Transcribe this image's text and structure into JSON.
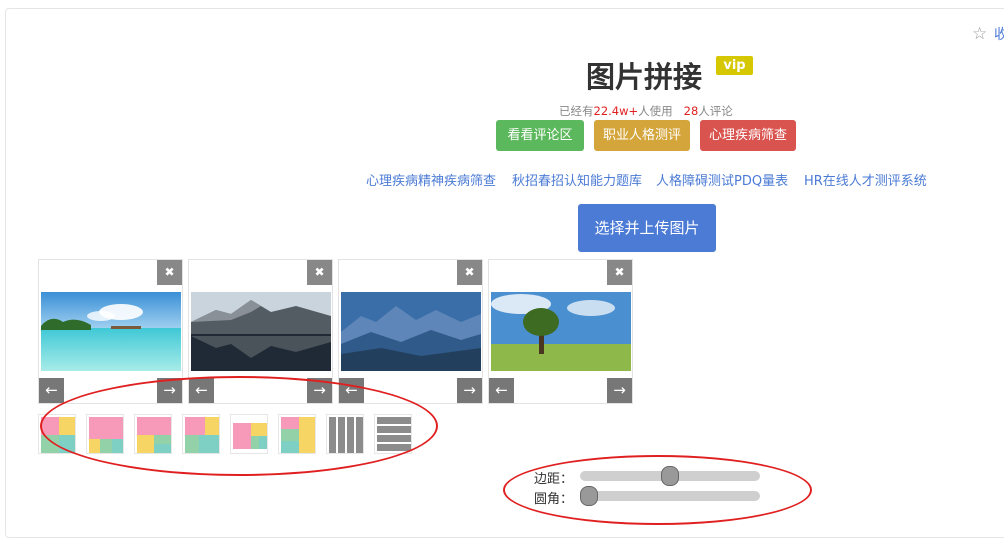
{
  "header": {
    "favorite_label": "收",
    "title": "图片拼接",
    "vip_badge": "vip",
    "stats": {
      "prefix": "已经有",
      "users": "22.4w+",
      "users_suffix": "人使用",
      "comments": "28",
      "comments_suffix": "人评论"
    }
  },
  "buttons": {
    "view_comments": "看看评论区",
    "career_test": "职业人格测评",
    "mental_screening": "心理疾病筛查"
  },
  "links": [
    "心理疾病精神疾病筛查",
    "秋招春招认知能力题库",
    "人格障碍测试PDQ量表",
    "HR在线人才测评系统"
  ],
  "upload_button": "选择并上传图片",
  "images": [
    {
      "id": "beach",
      "close": "✖",
      "left": "←",
      "right": "→"
    },
    {
      "id": "lake",
      "close": "✖",
      "left": "←",
      "right": "→"
    },
    {
      "id": "mountains",
      "close": "✖",
      "left": "←",
      "right": "→"
    },
    {
      "id": "tree",
      "close": "✖",
      "left": "←",
      "right": "→"
    }
  ],
  "layout_options": [
    "layout-1",
    "layout-2",
    "layout-3",
    "layout-4",
    "layout-5",
    "layout-6",
    "layout-vertical-strips",
    "layout-horizontal-strips"
  ],
  "controls": {
    "spacing_label": "边距：",
    "spacing_value": 0.5,
    "radius_label": "圆角：",
    "radius_value": 0.0
  },
  "colors": {
    "accent": "#4b7bd5",
    "annotation": "#e02020"
  }
}
